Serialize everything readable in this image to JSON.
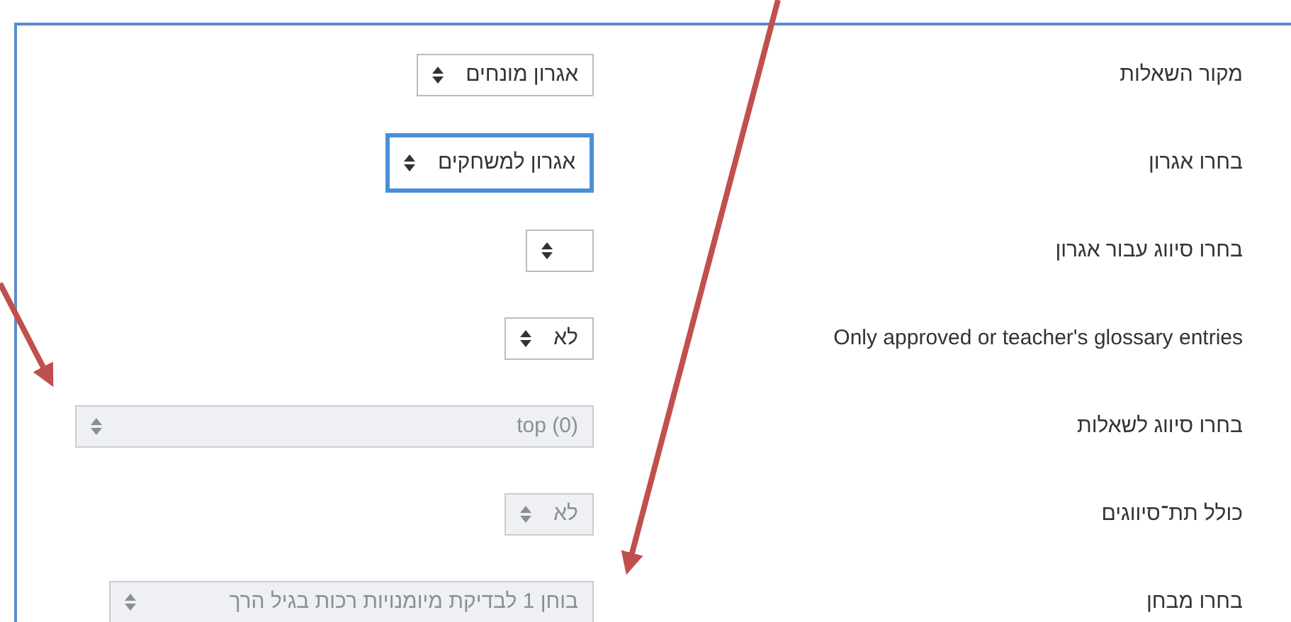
{
  "rows": [
    {
      "label": "מקור השאלות",
      "select": {
        "value": "אגרון מונחים",
        "disabled": false,
        "focused": false
      }
    },
    {
      "label": "בחרו אגרון",
      "select": {
        "value": "אגרון למשחקים",
        "disabled": false,
        "focused": true
      }
    },
    {
      "label": "בחרו סיווג עבור אגרון",
      "select": {
        "disabled": false,
        "focused": false
      }
    },
    {
      "label": "Only approved or teacher's glossary entries",
      "select": {
        "value": "לא",
        "disabled": false,
        "focused": false
      }
    },
    {
      "label": "בחרו סיווג לשאלות",
      "select": {
        "value": "top (0)",
        "disabled": true,
        "focused": false
      }
    },
    {
      "label": "כולל תת־סיווגים",
      "select": {
        "value": "לא",
        "disabled": true,
        "focused": false
      }
    },
    {
      "label": "בחרו מבחן",
      "select": {
        "value": "בוחן 1 לבדיקת מיומנויות רכות בגיל הרך",
        "disabled": true,
        "focused": false
      }
    }
  ]
}
